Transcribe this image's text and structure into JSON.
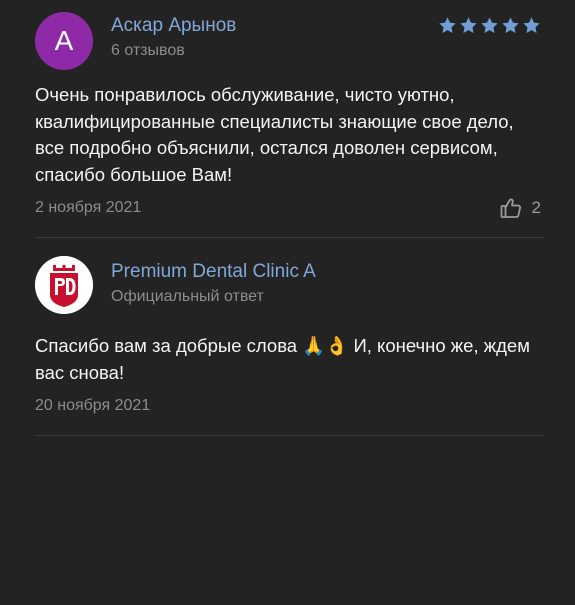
{
  "review": {
    "avatar_letter": "A",
    "avatar_color": "#8e2aa8",
    "author_name": "Аскар Арынов",
    "author_meta": "6 отзывов",
    "rating": 5,
    "rating_max": 5,
    "star_color": "#6f9fd6",
    "text": "Очень понравилось обслуживание, чисто уютно, квалифицированные специалисты знающие свое дело, все подробно объяснили, остался доволен сервисом, спасибо большое Вам!",
    "date": "2 ноября 2021",
    "like_icon": "thumbs-up-icon",
    "like_count": "2"
  },
  "reply": {
    "logo_icon": "clinic-logo-icon",
    "logo_color": "#c8102e",
    "author_name": "Premium Dental Clinic A",
    "author_meta": "Официальный ответ",
    "text": "Спасибо вам за добрые слова 🙏👌 И, конечно же, ждем вас снова!",
    "date": "20 ноября 2021"
  }
}
